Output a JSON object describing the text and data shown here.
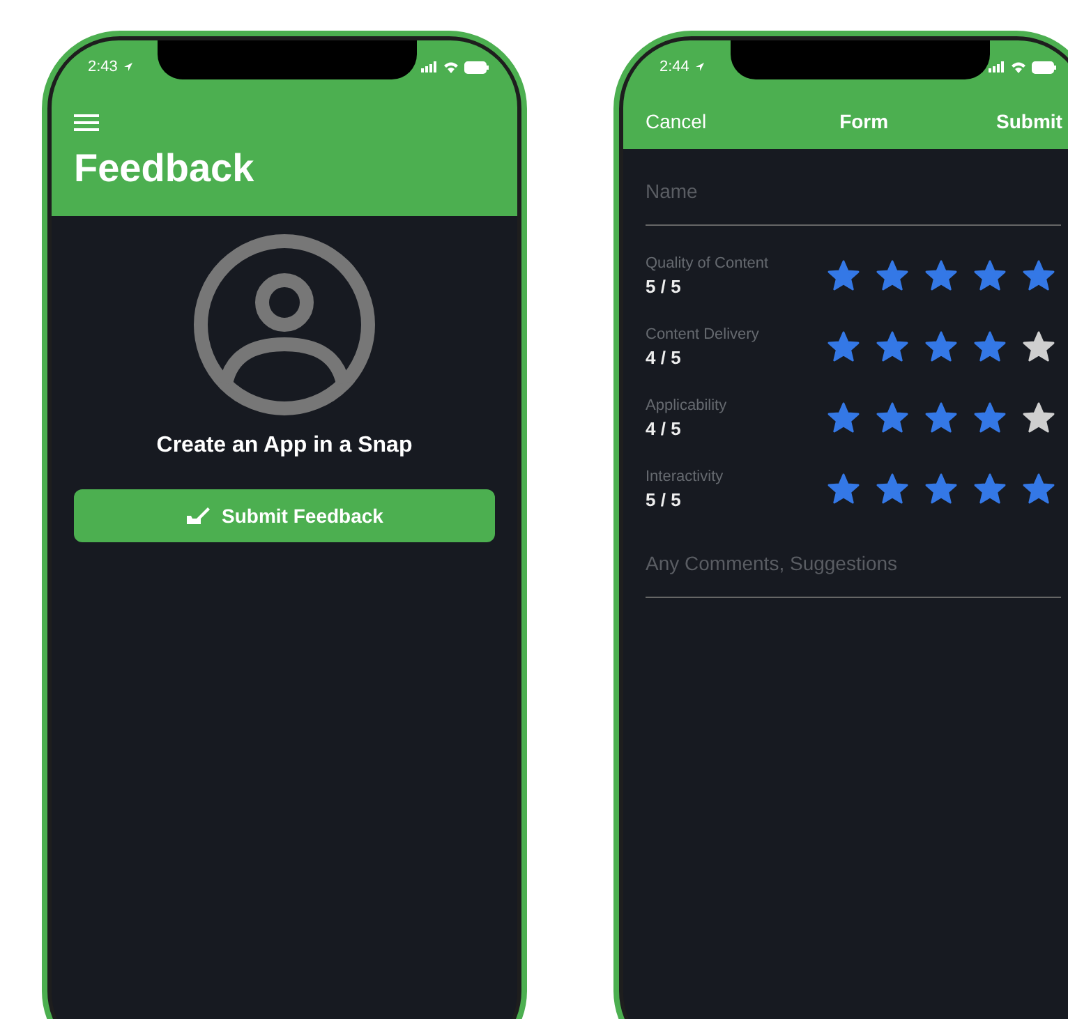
{
  "phones": [
    {
      "kind": "home",
      "time": "2:43",
      "title": "Feedback",
      "tagline": "Create an App in a Snap",
      "button": "Submit Feedback"
    },
    {
      "kind": "form",
      "time": "2:44",
      "nav": {
        "cancel": "Cancel",
        "title": "Form",
        "submit": "Submit"
      },
      "name_field": {
        "placeholder": "Name"
      },
      "ratings": [
        {
          "label": "Quality of Content",
          "score": "5 / 5",
          "stars": 5
        },
        {
          "label": "Content Delivery",
          "score": "4 / 5",
          "stars": 4
        },
        {
          "label": "Applicability",
          "score": "4 / 5",
          "stars": 4
        },
        {
          "label": "Interactivity",
          "score": "5 / 5",
          "stars": 5
        }
      ],
      "comments_field": {
        "placeholder": "Any Comments, Suggestions"
      }
    }
  ]
}
